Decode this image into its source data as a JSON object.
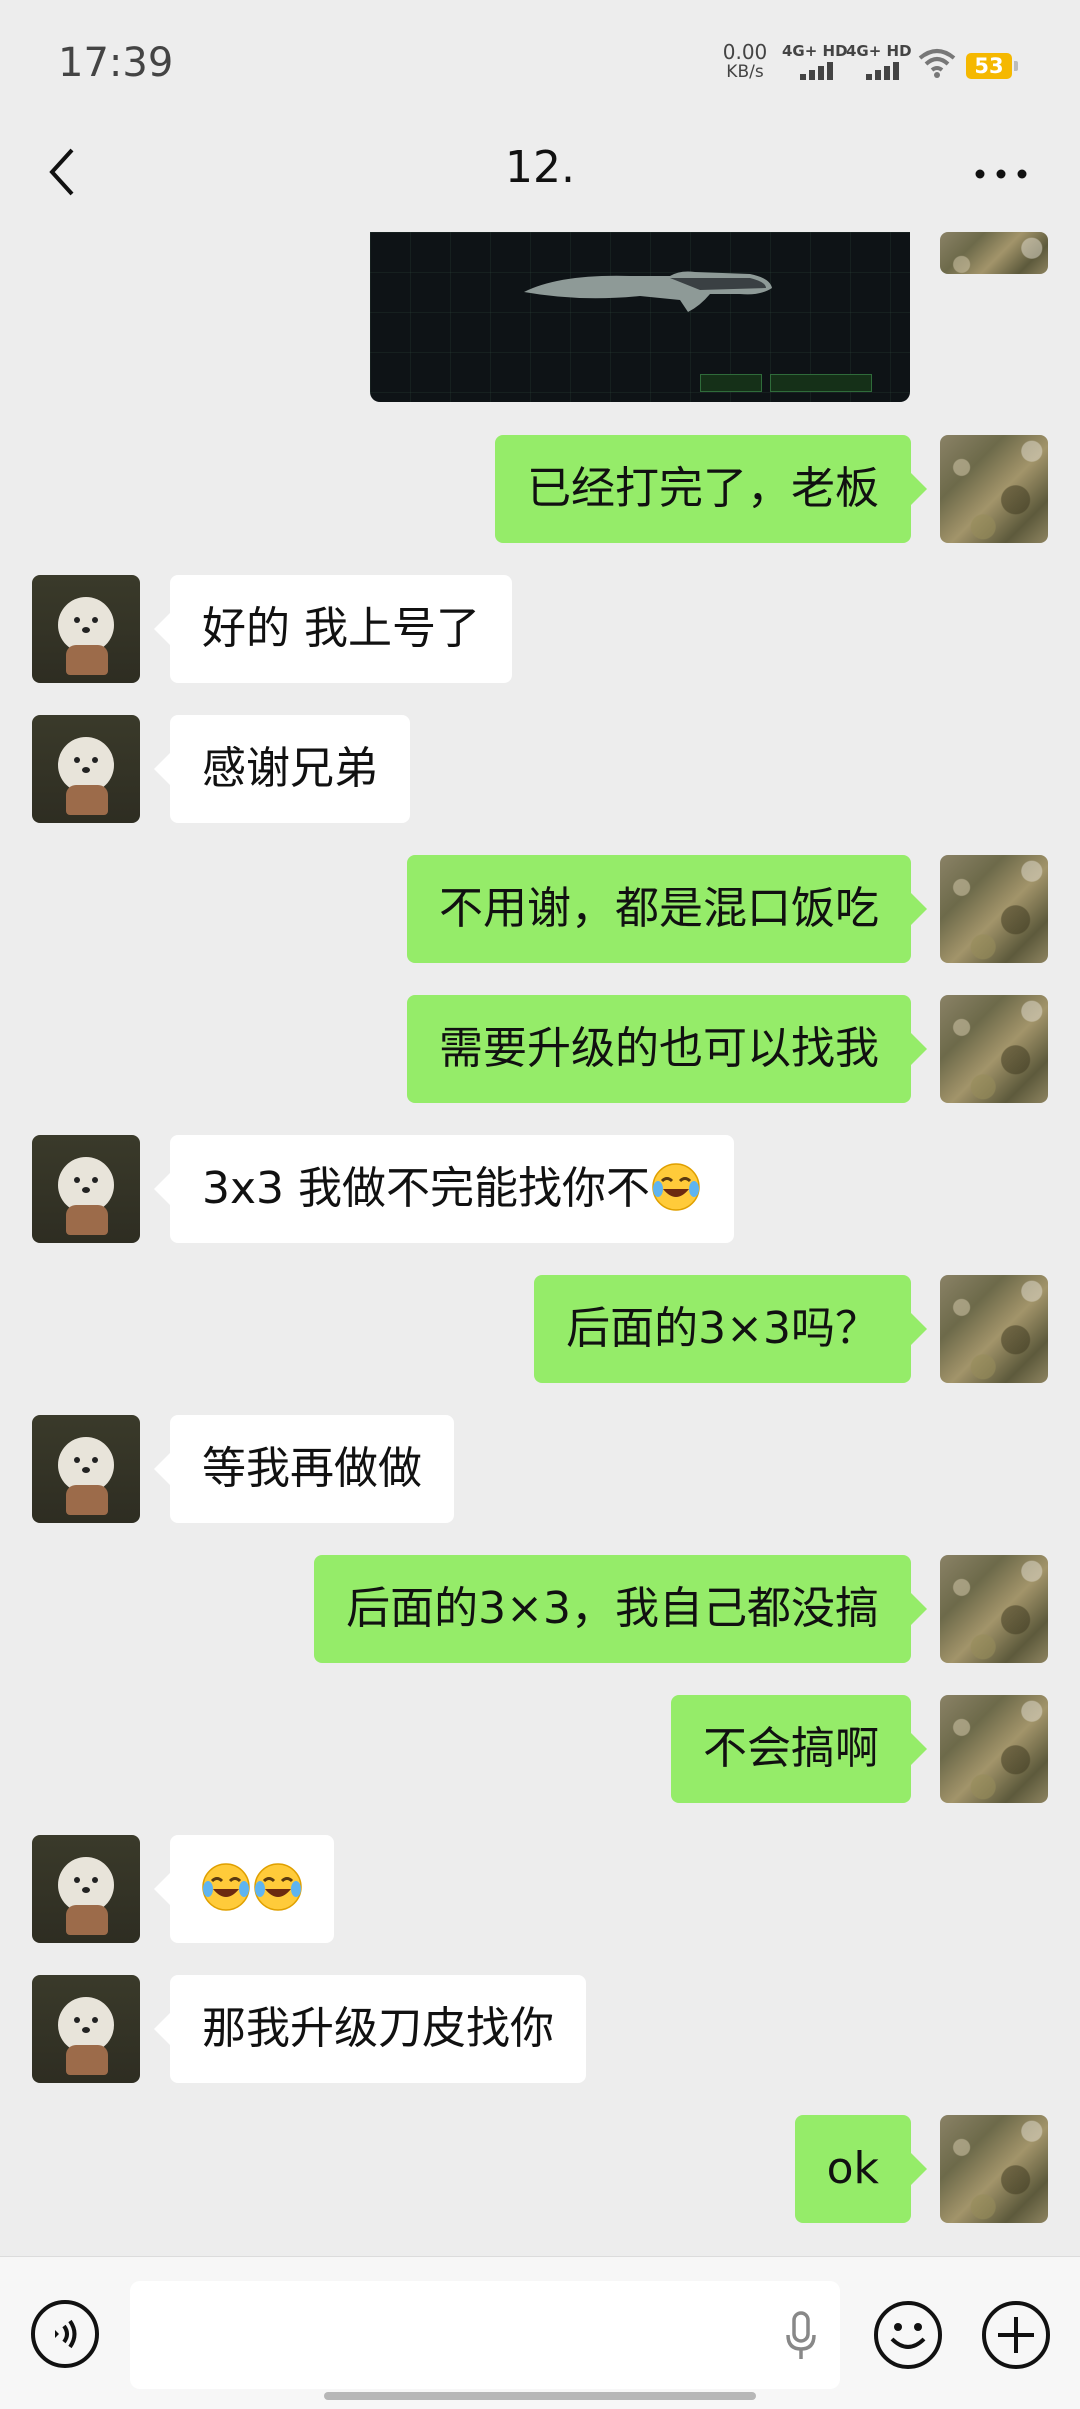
{
  "status": {
    "time": "17:39",
    "net_speed_value": "0.00",
    "net_speed_unit": "KB/s",
    "sim1": "4G+ HD",
    "sim2": "4G+ HD",
    "battery": "53",
    "icons": [
      "signal-icon",
      "wifi-icon",
      "battery-icon"
    ]
  },
  "header": {
    "title": "12.",
    "back_icon": "chevron-left-icon",
    "more_icon": "ellipsis-icon"
  },
  "messages": [
    {
      "from": "me",
      "type": "image",
      "content": "knife skin screenshot"
    },
    {
      "from": "me",
      "text": "已经打完了，老板"
    },
    {
      "from": "them",
      "text": "好的 我上号了"
    },
    {
      "from": "them",
      "text": "感谢兄弟"
    },
    {
      "from": "me",
      "text": "不用谢，都是混口饭吃"
    },
    {
      "from": "me",
      "text": "需要升级的也可以找我"
    },
    {
      "from": "them",
      "text": "3x3 我做不完能找你不"
    },
    {
      "from": "me",
      "text": "后面的3×3吗？"
    },
    {
      "from": "them",
      "text": "等我再做做"
    },
    {
      "from": "me",
      "text": "后面的3×3，我自己都没搞"
    },
    {
      "from": "me",
      "text": "不会搞啊"
    },
    {
      "from": "them",
      "text": "",
      "emoji": [
        "face-with-tears-of-joy-icon",
        "face-with-tears-of-joy-icon"
      ]
    },
    {
      "from": "them",
      "text": "那我升级刀皮找你"
    },
    {
      "from": "me",
      "text": "ok"
    }
  ],
  "input_bar": {
    "voice_icon": "voice-mode-icon",
    "mic_icon": "microphone-icon",
    "emoji_icon": "smiley-icon",
    "plus_icon": "plus-icon",
    "value": ""
  },
  "colors": {
    "my_bubble": "#95ec69",
    "their_bubble": "#ffffff",
    "background": "#ededed",
    "battery": "#f5b800"
  }
}
